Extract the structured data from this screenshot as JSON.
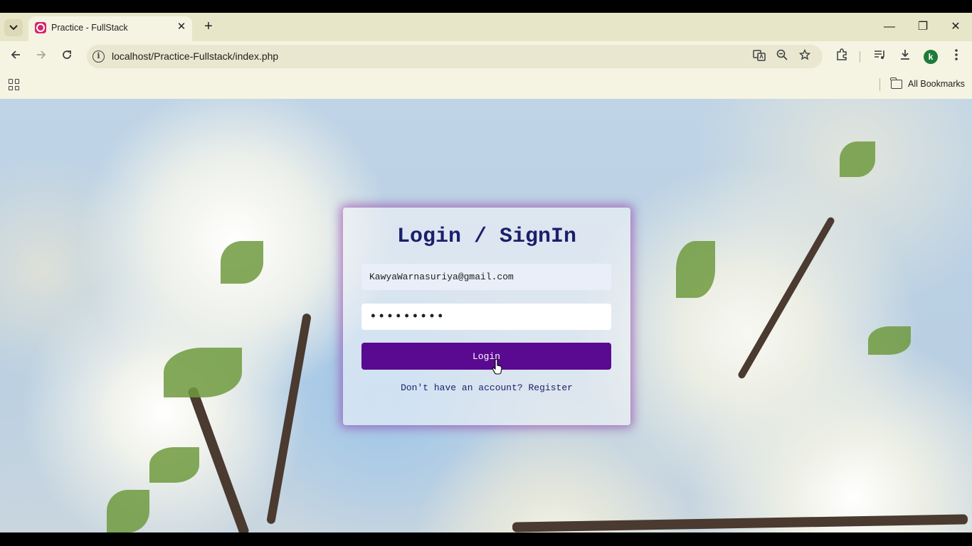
{
  "browser": {
    "tab": {
      "title": "Practice - FullStack",
      "close_glyph": "✕",
      "favicon": "xampp-icon"
    },
    "new_tab_glyph": "+",
    "window_controls": {
      "minimize": "—",
      "restore": "❐",
      "close": "✕"
    },
    "address_bar": {
      "url": "localhost/Practice-Fullstack/index.php"
    },
    "profile_initial": "k",
    "bookmarks": {
      "all_bookmarks_label": "All Bookmarks"
    }
  },
  "login": {
    "title": "Login / SignIn",
    "email_value": "KawyaWarnasuriya@gmail.com",
    "password_mask": "•••••••••",
    "login_button": "Login",
    "register_prompt": "Don't have an account? Register"
  },
  "colors": {
    "title": "#1a1f6b",
    "login_button_bg": "#5a0a91",
    "card_glow": "#8c28a0"
  }
}
